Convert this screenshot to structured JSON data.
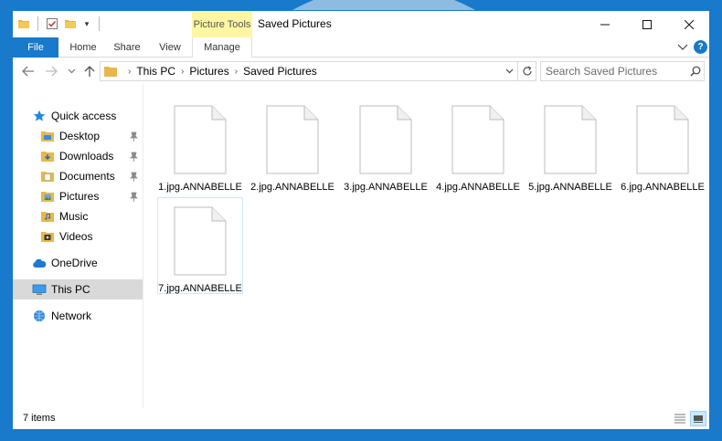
{
  "titlebar": {
    "title": "Saved Pictures",
    "context_tab": "Picture Tools",
    "quick_access_icons": [
      "folder-icon",
      "properties-check-icon",
      "new-folder-icon",
      "customize-dropdown-icon"
    ],
    "controls": [
      "minimize-icon",
      "maximize-icon",
      "close-icon"
    ]
  },
  "ribbon": {
    "tabs": [
      {
        "label": "File",
        "name": "tab-file"
      },
      {
        "label": "Home",
        "name": "tab-home"
      },
      {
        "label": "Share",
        "name": "tab-share"
      },
      {
        "label": "View",
        "name": "tab-view"
      },
      {
        "label": "Manage",
        "name": "tab-manage"
      }
    ],
    "help_label": "?"
  },
  "address": {
    "crumbs": [
      "This PC",
      "Pictures",
      "Saved Pictures"
    ],
    "search_placeholder": "Search Saved Pictures"
  },
  "navpane": {
    "items": [
      {
        "label": "Quick access",
        "icon": "star-icon",
        "pinned": false
      },
      {
        "label": "Desktop",
        "icon": "desktop-folder-icon",
        "pinned": true
      },
      {
        "label": "Downloads",
        "icon": "downloads-folder-icon",
        "pinned": true
      },
      {
        "label": "Documents",
        "icon": "documents-folder-icon",
        "pinned": true
      },
      {
        "label": "Pictures",
        "icon": "pictures-folder-icon",
        "pinned": true
      },
      {
        "label": "Music",
        "icon": "music-folder-icon",
        "pinned": false
      },
      {
        "label": "Videos",
        "icon": "videos-folder-icon",
        "pinned": false
      },
      {
        "label": "OneDrive",
        "icon": "cloud-icon",
        "pinned": false
      },
      {
        "label": "This PC",
        "icon": "computer-icon",
        "pinned": false,
        "selected": true
      },
      {
        "label": "Network",
        "icon": "network-icon",
        "pinned": false
      }
    ]
  },
  "files": [
    {
      "name": "1.jpg.ANNABELLE"
    },
    {
      "name": "2.jpg.ANNABELLE"
    },
    {
      "name": "3.jpg.ANNABELLE"
    },
    {
      "name": "4.jpg.ANNABELLE"
    },
    {
      "name": "5.jpg.ANNABELLE"
    },
    {
      "name": "6.jpg.ANNABELLE"
    },
    {
      "name": "7.jpg.ANNABELLE",
      "selected": true
    }
  ],
  "status": {
    "item_count": "7 items"
  },
  "colors": {
    "accent": "#1979ca",
    "context_tab": "#fff6a3",
    "selection": "#cce8ff",
    "watermark": "#e9ecef",
    "watermark_red": "#fbeaea"
  }
}
